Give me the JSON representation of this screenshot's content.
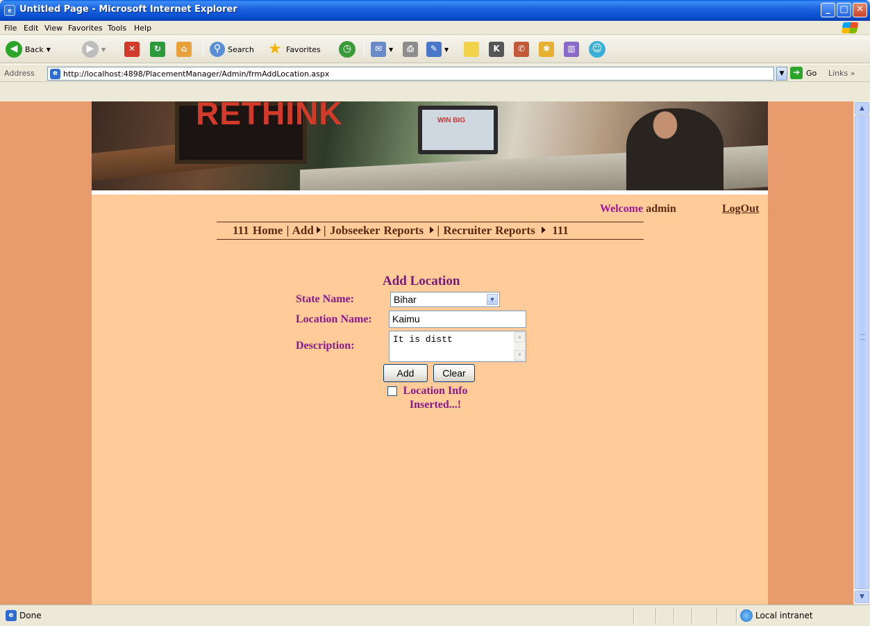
{
  "window": {
    "title": "Untitled Page - Microsoft Internet Explorer",
    "controls": {
      "minimize": "_",
      "maximize": "□",
      "close": "✕"
    }
  },
  "menu": [
    "File",
    "Edit",
    "View",
    "Favorites",
    "Tools",
    "Help"
  ],
  "toolbar": {
    "back_label": "Back",
    "search_label": "Search",
    "favorites_label": "Favorites"
  },
  "address": {
    "label": "Address",
    "url": "http://localhost:4898/PlacementManager/Admin/frmAddLocation.aspx",
    "go_label": "Go",
    "links_label": "Links"
  },
  "page": {
    "banner_text": "RETHINK",
    "banner_monitor_text": "WIN BIG",
    "welcome_label": "Welcome",
    "username": "admin",
    "logout_label": "LogOut",
    "nav": {
      "prefix": "111",
      "home": "Home",
      "add": "Add",
      "jobseeker": "Jobseeker Reports",
      "recruiter": "Recruiter Reports",
      "suffix": "111"
    },
    "form": {
      "title": "Add Location",
      "state_label": "State Name:",
      "state_value": "Bihar",
      "location_label": "Location Name:",
      "location_value": "Kaimu",
      "description_label": "Description:",
      "description_value": "It is distt",
      "add_button": "Add",
      "clear_button": "Clear",
      "message": "Location Info Inserted...!"
    }
  },
  "status": {
    "text": "Done",
    "zone": "Local intranet"
  },
  "colors": {
    "page_background": "#ffcc99",
    "side_background": "#e89b6c",
    "label_color": "#8a1a88",
    "nav_color": "#5a2a12"
  }
}
